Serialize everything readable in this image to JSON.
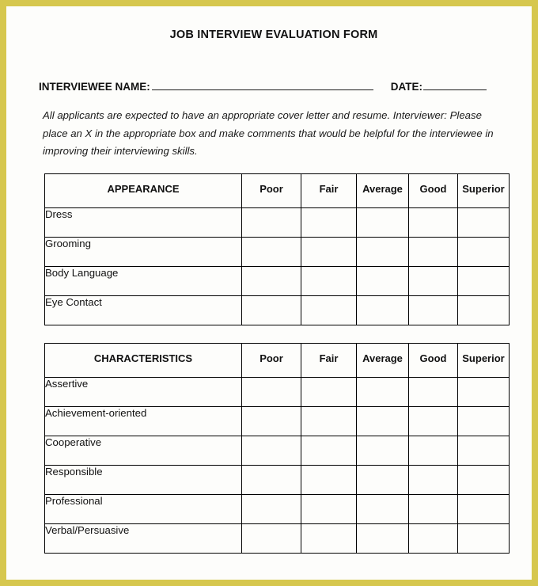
{
  "page": {
    "border_color": "#d6c74e",
    "background_color": "#fdfdfb"
  },
  "header": {
    "title": "JOB INTERVIEW EVALUATION FORM"
  },
  "identity": {
    "interviewee_label": "INTERVIEWEE NAME:",
    "interviewee_value": "",
    "date_label": "DATE:",
    "date_value": ""
  },
  "instructions": {
    "line1": "All applicants are expected to have an appropriate cover letter and resume. Interviewer:",
    "line2": "Please place an X in the appropriate box and make comments that would be helpful for",
    "line3": "the interviewee in improving their interviewing skills."
  },
  "rating_scale": {
    "poor": "Poor",
    "fair": "Fair",
    "average": "Average",
    "good": "Good",
    "superior": "Superior"
  },
  "tables": [
    {
      "section_title": "APPEARANCE",
      "columns": [
        "APPEARANCE",
        "Poor",
        "Fair",
        "Average",
        "Good",
        "Superior"
      ],
      "rows": [
        {
          "label": "Dress",
          "poor": "",
          "fair": "",
          "average": "",
          "good": "",
          "superior": ""
        },
        {
          "label": "Grooming",
          "poor": "",
          "fair": "",
          "average": "",
          "good": "",
          "superior": ""
        },
        {
          "label": "Body Language",
          "poor": "",
          "fair": "",
          "average": "",
          "good": "",
          "superior": ""
        },
        {
          "label": "Eye Contact",
          "poor": "",
          "fair": "",
          "average": "",
          "good": "",
          "superior": ""
        }
      ]
    },
    {
      "section_title": "CHARACTERISTICS",
      "columns": [
        "CHARACTERISTICS",
        "Poor",
        "Fair",
        "Average",
        "Good",
        "Superior"
      ],
      "rows": [
        {
          "label": "Assertive",
          "poor": "",
          "fair": "",
          "average": "",
          "good": "",
          "superior": ""
        },
        {
          "label": "Achievement-oriented",
          "poor": "",
          "fair": "",
          "average": "",
          "good": "",
          "superior": ""
        },
        {
          "label": "Cooperative",
          "poor": "",
          "fair": "",
          "average": "",
          "good": "",
          "superior": ""
        },
        {
          "label": "Responsible",
          "poor": "",
          "fair": "",
          "average": "",
          "good": "",
          "superior": ""
        },
        {
          "label": "Professional",
          "poor": "",
          "fair": "",
          "average": "",
          "good": "",
          "superior": ""
        },
        {
          "label": "Verbal/Persuasive",
          "poor": "",
          "fair": "",
          "average": "",
          "good": "",
          "superior": ""
        }
      ]
    }
  ]
}
